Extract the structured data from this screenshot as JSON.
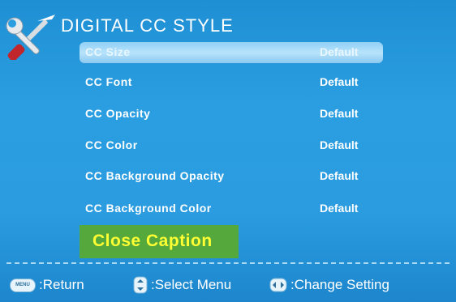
{
  "header": {
    "title": "DIGITAL CC STYLE",
    "icon": "tools-icon"
  },
  "menu": {
    "items": [
      {
        "label": "CC Size",
        "value": "Default"
      },
      {
        "label": "CC Font",
        "value": "Default"
      },
      {
        "label": "CC Opacity",
        "value": "Default"
      },
      {
        "label": "CC Color",
        "value": "Default"
      },
      {
        "label": "CC Background Opacity",
        "value": "Default"
      },
      {
        "label": "CC Background Color",
        "value": "Default"
      }
    ],
    "selected_index": 0
  },
  "preview": {
    "text": "Close Caption",
    "background": "#55a83c",
    "text_color": "#ffff33"
  },
  "footer": {
    "menu_key": "MENU",
    "return_label": ":Return",
    "select_label": ":Select Menu",
    "change_label": ":Change Setting"
  },
  "colors": {
    "background": "#2a9ee0",
    "highlight": "#b8e3fb",
    "text": "#ffffff"
  }
}
